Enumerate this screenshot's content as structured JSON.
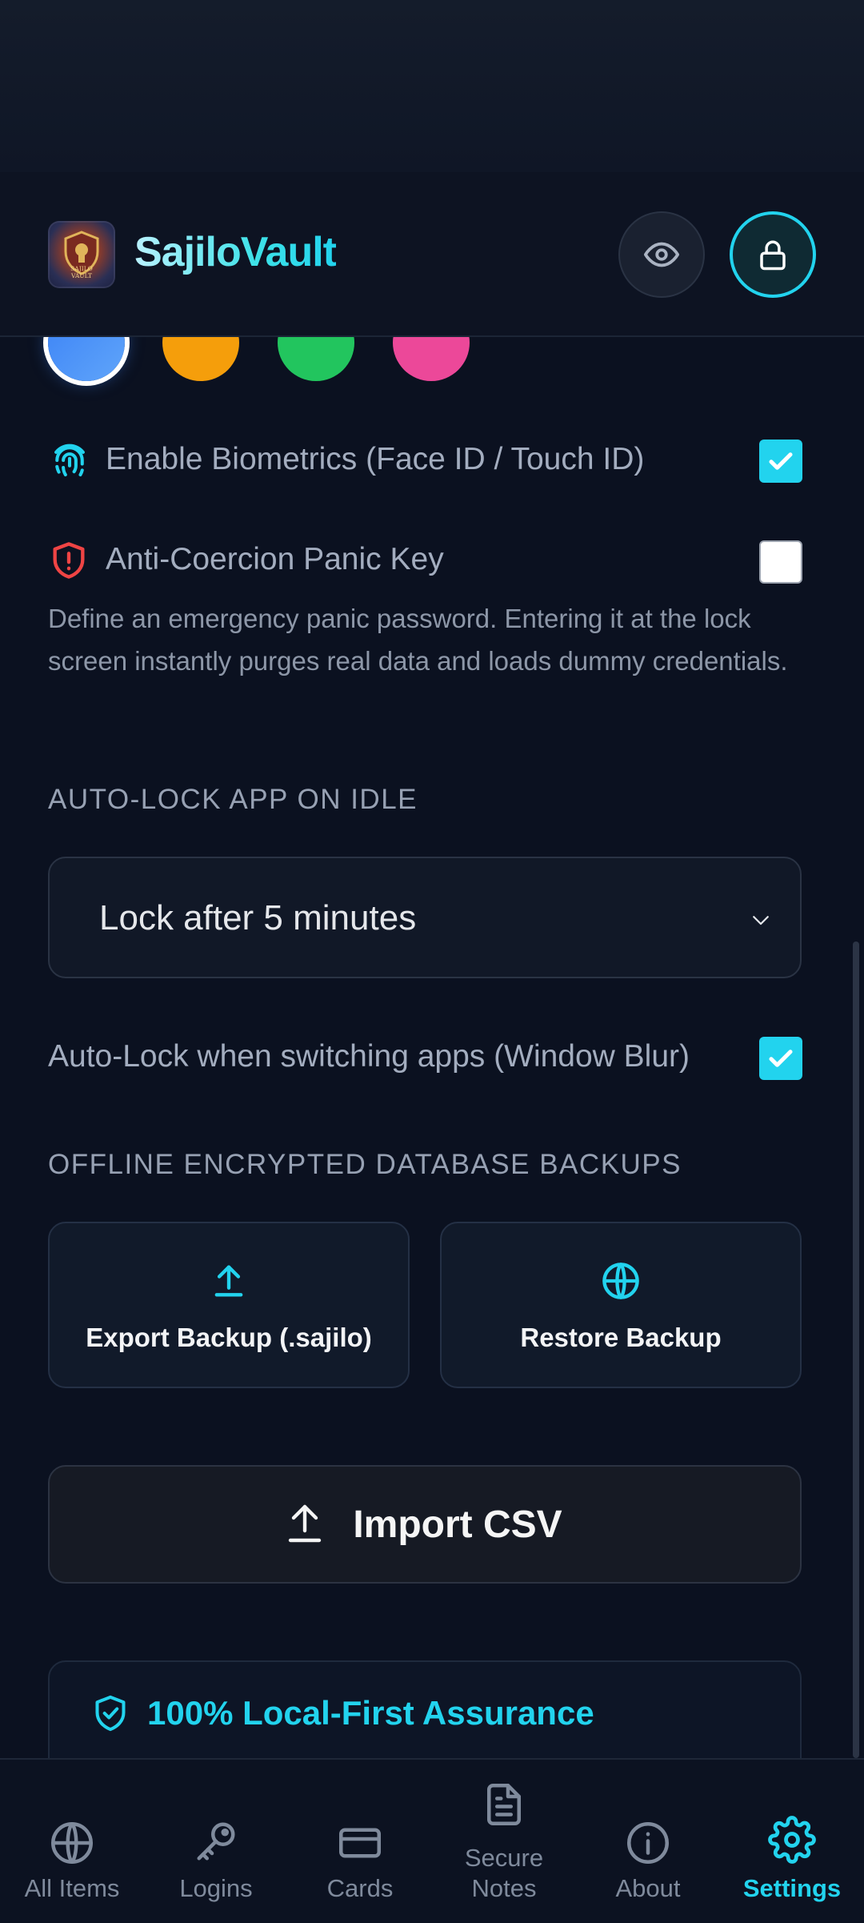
{
  "app": {
    "title": "SajiloVault",
    "logo_text": "SAJILO VAULT"
  },
  "header": {
    "privacy_toggle_icon": "eye-icon",
    "lock_icon": "lock-icon"
  },
  "theme_swatches": [
    {
      "name": "blue",
      "color": "#3b82f6",
      "selected": true
    },
    {
      "name": "orange",
      "color": "#f59e0b",
      "selected": false
    },
    {
      "name": "green",
      "color": "#22c55e",
      "selected": false
    },
    {
      "name": "pink",
      "color": "#ec4899",
      "selected": false
    }
  ],
  "security": {
    "biometrics_label": "Enable Biometrics (Face ID / Touch ID)",
    "biometrics_checked": true,
    "panic_label": "Anti-Coercion Panic Key",
    "panic_checked": false,
    "panic_description": "Define an emergency panic password. Entering it at the lock screen instantly purges real data and loads dummy credentials."
  },
  "auto_lock": {
    "section_title": "AUTO-LOCK APP ON IDLE",
    "selected_option": "Lock after 5 minutes",
    "blur_label": "Auto-Lock when switching apps (Window Blur)",
    "blur_checked": true
  },
  "backups": {
    "section_title": "OFFLINE ENCRYPTED DATABASE BACKUPS",
    "export_label": "Export Backup (.sajilo)",
    "restore_label": "Restore Backup",
    "import_label": "Import CSV"
  },
  "assurance": {
    "title": "100% Local-First Assurance"
  },
  "nav": {
    "items": [
      {
        "label": "All Items",
        "icon": "globe-icon"
      },
      {
        "label": "Logins",
        "icon": "key-icon"
      },
      {
        "label": "Cards",
        "icon": "credit-card-icon"
      },
      {
        "label": "Secure\nNotes",
        "line1": "Secure",
        "line2": "Notes",
        "icon": "note-icon"
      },
      {
        "label": "About",
        "icon": "info-icon"
      },
      {
        "label": "Settings",
        "icon": "gear-icon",
        "active": true
      }
    ]
  },
  "colors": {
    "accent": "#22d3ee",
    "background": "#0b1120",
    "danger": "#ef4444"
  }
}
